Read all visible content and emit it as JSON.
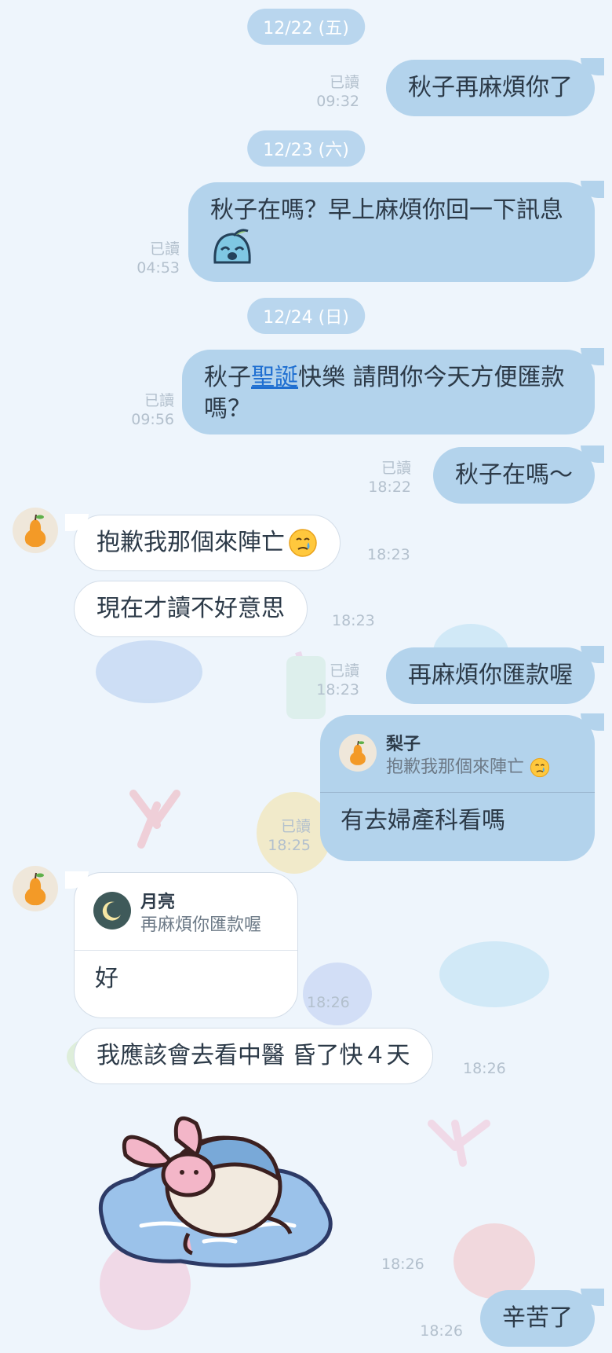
{
  "dates": {
    "d1": "12/22 (五)",
    "d2": "12/23 (六)",
    "d3": "12/24 (日)"
  },
  "messages": {
    "m1": {
      "text": "秋子再麻煩你了",
      "read": "已讀",
      "time": "09:32"
    },
    "m2": {
      "text": "秋子在嗎？早上麻煩你回一下訊息",
      "read": "已讀",
      "time": "04:53"
    },
    "m3": {
      "text_before": "秋子",
      "link": "聖誕",
      "text_after": "快樂 請問你今天方便匯款嗎？",
      "read": "已讀",
      "time": "09:56"
    },
    "m4": {
      "text": "秋子在嗎～",
      "read": "已讀",
      "time": "18:22"
    },
    "m5": {
      "text": "抱歉我那個來陣亡",
      "time": "18:23"
    },
    "m6": {
      "text": "現在才讀不好意思",
      "time": "18:23"
    },
    "m7": {
      "text": "再麻煩你匯款喔",
      "read": "已讀",
      "time": "18:23"
    },
    "m8": {
      "reply_name": "梨子",
      "reply_quote": "抱歉我那個來陣亡",
      "text": "有去婦產科看嗎",
      "read": "已讀",
      "time": "18:25"
    },
    "m9": {
      "reply_name": "月亮",
      "reply_quote": "再麻煩你匯款喔",
      "text": "好",
      "time": "18:26"
    },
    "m10": {
      "text": "我應該會去看中醫 昏了快４天",
      "time": "18:26"
    },
    "m11": {
      "sticker": "pink-rabbit-melting-sticker",
      "time": "18:26"
    },
    "m12": {
      "text": "辛苦了",
      "time": "18:26"
    }
  },
  "colors": {
    "background": "#eef5fc",
    "sent_bubble": "#b3d3ec",
    "recv_bubble": "#ffffff",
    "date_pill": "#b9d6ee",
    "link": "#1f6fd1",
    "meta_text": "#b3c0cd"
  },
  "avatars": {
    "contact": "pear-avatar-icon",
    "me": "moon-avatar-icon"
  }
}
